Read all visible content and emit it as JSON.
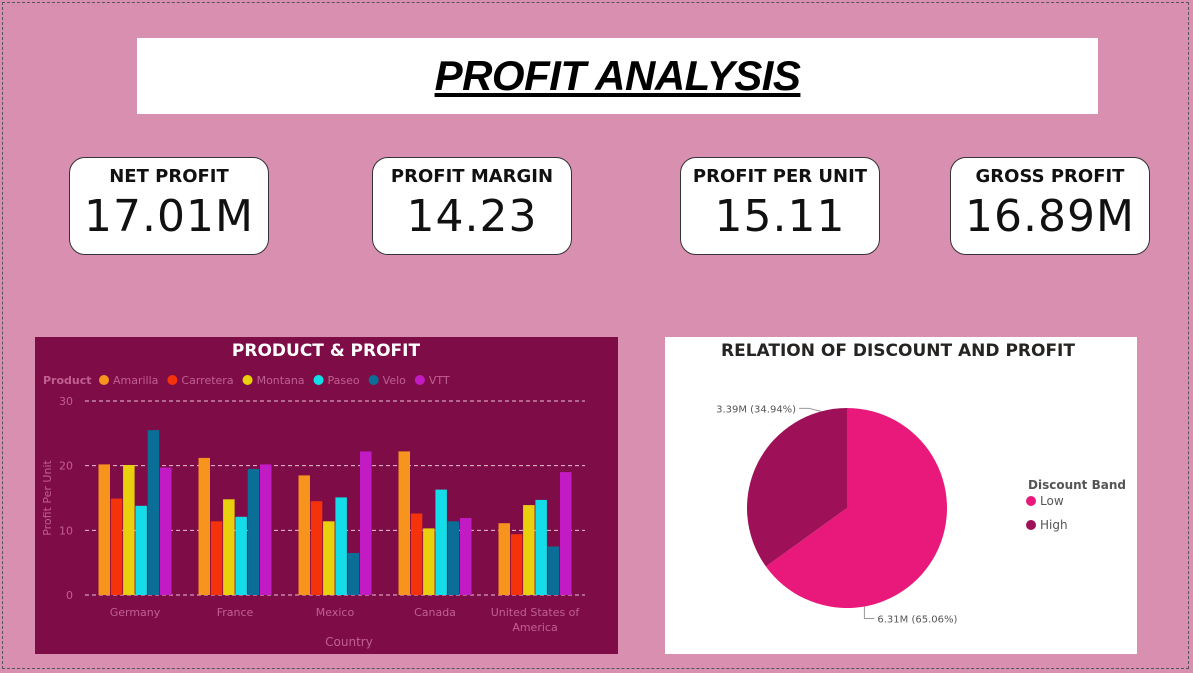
{
  "page": {
    "title": "PROFIT ANALYSIS"
  },
  "cards": [
    {
      "label": "NET PROFIT",
      "value": "17.01M"
    },
    {
      "label": "PROFIT MARGIN",
      "value": "14.23"
    },
    {
      "label": "PROFIT PER UNIT",
      "value": "15.11"
    },
    {
      "label": "GROSS PROFIT",
      "value": "16.89M"
    }
  ],
  "chart_data": [
    {
      "type": "bar",
      "title": "PRODUCT & PROFIT",
      "xlabel": "Country",
      "ylabel": "Profit Per Unit",
      "legend_title": "Product",
      "legend_position": "top-left",
      "ylim": [
        0,
        30
      ],
      "yticks": [
        0,
        10,
        20,
        30
      ],
      "grid": true,
      "categories": [
        "Germany",
        "France",
        "Mexico",
        "Canada",
        "United States of America"
      ],
      "series": [
        {
          "name": "Amarilla",
          "color": "#f7941d",
          "values": [
            20.2,
            21.2,
            18.5,
            22.2,
            11.1
          ]
        },
        {
          "name": "Carretera",
          "color": "#f4330a",
          "values": [
            14.9,
            11.4,
            14.5,
            12.6,
            9.4
          ]
        },
        {
          "name": "Montana",
          "color": "#e8d10c",
          "values": [
            20.1,
            14.8,
            11.4,
            10.3,
            13.9
          ]
        },
        {
          "name": "Paseo",
          "color": "#13dde8",
          "values": [
            13.8,
            12.1,
            15.1,
            16.3,
            14.7
          ]
        },
        {
          "name": "Velo",
          "color": "#0a6e96",
          "values": [
            25.5,
            19.5,
            6.5,
            11.4,
            7.5
          ]
        },
        {
          "name": "VTT",
          "color": "#c21bc4",
          "values": [
            19.7,
            20.2,
            22.2,
            11.9,
            19.0
          ]
        }
      ],
      "colors": {
        "background": "#7e0c47",
        "text": "#c06090",
        "title": "#ffffff"
      }
    },
    {
      "type": "pie",
      "title": "RELATION OF DISCOUNT AND PROFIT",
      "legend_title": "Discount Band",
      "legend_position": "right",
      "slices": [
        {
          "name": "Low",
          "value": 6.31,
          "percent": 65.06,
          "label": "6.31M (65.06%)",
          "color": "#e8197a"
        },
        {
          "name": "High",
          "value": 3.39,
          "percent": 34.94,
          "label": "3.39M (34.94%)",
          "color": "#9e1057"
        }
      ]
    }
  ]
}
